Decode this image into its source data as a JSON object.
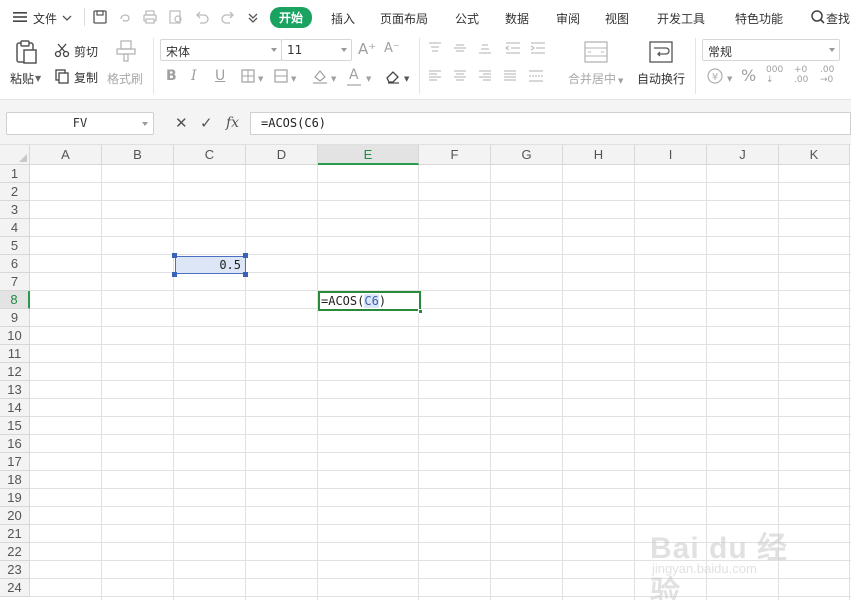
{
  "menu": {
    "file_label": "文件",
    "tabs": [
      "开始",
      "插入",
      "页面布局",
      "公式",
      "数据",
      "审阅",
      "视图",
      "开发工具",
      "特色功能"
    ],
    "active_tab": "开始",
    "search_label": "查找"
  },
  "ribbon": {
    "paste_label": "粘贴",
    "cut_label": "剪切",
    "copy_label": "复制",
    "format_painter_label": "格式刷",
    "font_name": "宋体",
    "font_size": "11",
    "merge_center_label": "合并居中",
    "wrap_text_label": "自动换行",
    "number_format": "常规"
  },
  "formula_bar": {
    "name_box": "FV",
    "formula": "=ACOS(C6)"
  },
  "grid": {
    "columns": [
      "A",
      "B",
      "C",
      "D",
      "E",
      "F",
      "G",
      "H",
      "I",
      "J",
      "K"
    ],
    "rows": [
      "1",
      "2",
      "3",
      "4",
      "5",
      "6",
      "7",
      "8",
      "9",
      "10",
      "11",
      "12",
      "13",
      "14",
      "15",
      "16",
      "17",
      "18",
      "19",
      "20",
      "21",
      "22",
      "23",
      "24"
    ],
    "selected_column": "E",
    "selected_row": "8",
    "cells": {
      "C6": "0.5",
      "E8_prefix": "=ACOS(",
      "E8_ref": "C6",
      "E8_suffix": ")"
    }
  },
  "watermark": {
    "brand": "Bai du 经验",
    "url": "jingyan.baidu.com"
  }
}
